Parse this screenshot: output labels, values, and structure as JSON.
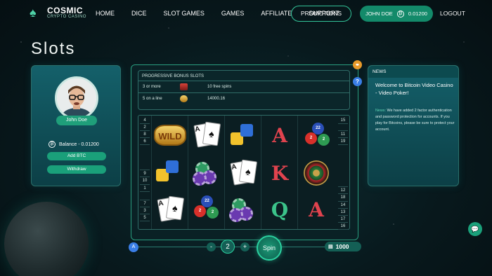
{
  "brand": {
    "title": "COSMIC",
    "subtitle": "CRYPTO CASINO"
  },
  "nav": [
    "HOME",
    "DICE",
    "SLOT GAMES",
    "GAMES",
    "AFFILIATE",
    "SUPPORT"
  ],
  "promotions_label": "PROMOTIONS",
  "user": {
    "name": "JOHN DOE",
    "balance": "0.01200"
  },
  "logout_label": "LOGOUT",
  "page_title": "Slots",
  "profile": {
    "name": "John Doe",
    "balance_text": "Balance - 0.01200",
    "add_btc": "Add BTC",
    "withdraw": "Withdraw"
  },
  "bonus": {
    "title": "PROGRESSIVE BONUS SLOTS",
    "rows": [
      {
        "condition": "3 or more",
        "icon": "slot-machine-icon",
        "reward": "10 free spins"
      },
      {
        "condition": "5 on a line",
        "icon": "wild-icon",
        "reward": "14000.16"
      }
    ]
  },
  "paylines_left": [
    "4",
    "2",
    "8",
    "6",
    "",
    "9",
    "10",
    "1",
    "",
    "7",
    "3",
    "5"
  ],
  "paylines_right": [
    "15",
    "",
    "11",
    "19",
    "",
    "",
    "",
    "",
    "12",
    "18",
    "14",
    "13",
    "17",
    "16"
  ],
  "reels": {
    "reel1": [
      "WILD",
      "dice",
      "cards-spade"
    ],
    "reel2": [
      "cards-spade",
      "poker-chips",
      "balls"
    ],
    "reel3": [
      "dice",
      "cards-spade",
      "poker-chips"
    ],
    "reel4": [
      "A",
      "K",
      "Q"
    ],
    "reel5": [
      "balls",
      "roulette",
      "A"
    ]
  },
  "reel_text": {
    "wild": "WILD",
    "ball_22": "22",
    "ball_2": "2",
    "ball_2b": "2",
    "a_upper": "A",
    "k": "K",
    "q": "Q",
    "a_lower": "A"
  },
  "controls": {
    "level": "A",
    "minus": "-",
    "bet": "2",
    "plus": "+",
    "spin": "Spin",
    "credits": "1000"
  },
  "news": {
    "header": "NEWS",
    "title": "Welcome to Bitcoin Video Casino - Video Poker!",
    "tag": "News:",
    "body": "We have added 2 factor authentication and password protection for accounts. If you play for Bitcoins, please be sure to protect your account."
  },
  "side_icons": {
    "link": "link-icon",
    "help": "?"
  },
  "colors": {
    "accent": "#1aa07a",
    "panel": "#14606a",
    "background": "#08191d"
  }
}
